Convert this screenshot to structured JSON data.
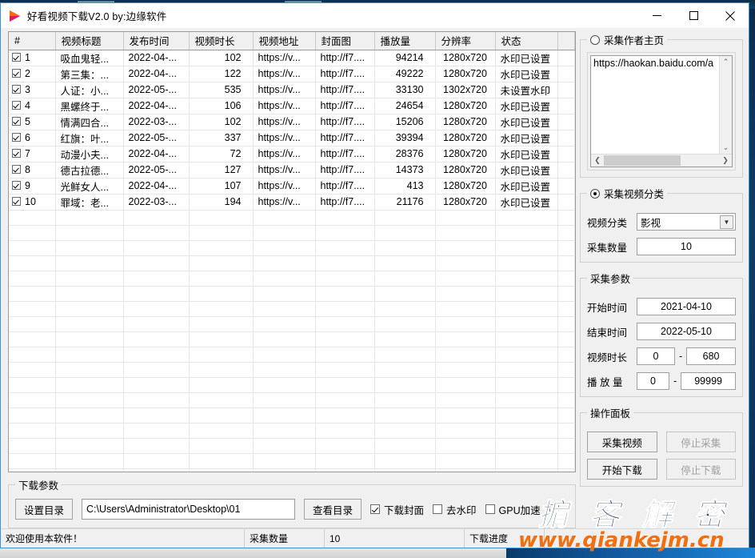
{
  "window": {
    "title": "好看视频下载V2.0 by:边缘软件",
    "logo_icon": "play-triangle-logo",
    "minimize_label": "—",
    "maximize_label": "□",
    "close_label": "✕"
  },
  "table": {
    "columns": [
      "#",
      "视频标题",
      "发布时间",
      "视频时长",
      "视频地址",
      "封面图",
      "播放量",
      "分辨率",
      "状态",
      ""
    ],
    "rows": [
      {
        "checked": true,
        "num": "1",
        "title": "吸血鬼轻...",
        "date": "2022-04-...",
        "duration": "102",
        "url": "https://v...",
        "cover": "http://f7....",
        "plays": "94214",
        "res": "1280x720",
        "status": "水印已设置"
      },
      {
        "checked": true,
        "num": "2",
        "title": "第三集：...",
        "date": "2022-04-...",
        "duration": "122",
        "url": "https://v...",
        "cover": "http://f7....",
        "plays": "49222",
        "res": "1280x720",
        "status": "水印已设置"
      },
      {
        "checked": true,
        "num": "3",
        "title": "人证：小...",
        "date": "2022-05-...",
        "duration": "535",
        "url": "https://v...",
        "cover": "http://f7....",
        "plays": "33130",
        "res": "1302x720",
        "status": "未设置水印"
      },
      {
        "checked": true,
        "num": "4",
        "title": "黑螺终于...",
        "date": "2022-04-...",
        "duration": "106",
        "url": "https://v...",
        "cover": "http://f7....",
        "plays": "24654",
        "res": "1280x720",
        "status": "水印已设置"
      },
      {
        "checked": true,
        "num": "5",
        "title": "情满四合...",
        "date": "2022-03-...",
        "duration": "102",
        "url": "https://v...",
        "cover": "http://f7....",
        "plays": "15206",
        "res": "1280x720",
        "status": "水印已设置"
      },
      {
        "checked": true,
        "num": "6",
        "title": "红旗：叶...",
        "date": "2022-05-...",
        "duration": "337",
        "url": "https://v...",
        "cover": "http://f7....",
        "plays": "39394",
        "res": "1280x720",
        "status": "水印已设置"
      },
      {
        "checked": true,
        "num": "7",
        "title": "动漫小夫...",
        "date": "2022-04-...",
        "duration": "72",
        "url": "https://v...",
        "cover": "http://f7....",
        "plays": "28376",
        "res": "1280x720",
        "status": "水印已设置"
      },
      {
        "checked": true,
        "num": "8",
        "title": "德古拉德...",
        "date": "2022-05-...",
        "duration": "127",
        "url": "https://v...",
        "cover": "http://f7....",
        "plays": "14373",
        "res": "1280x720",
        "status": "水印已设置"
      },
      {
        "checked": true,
        "num": "9",
        "title": "光鲜女人...",
        "date": "2022-04-...",
        "duration": "107",
        "url": "https://v...",
        "cover": "http://f7....",
        "plays": "413",
        "res": "1280x720",
        "status": "水印已设置"
      },
      {
        "checked": true,
        "num": "10",
        "title": "罪域：老...",
        "date": "2022-03-...",
        "duration": "194",
        "url": "https://v...",
        "cover": "http://f7....",
        "plays": "21176",
        "res": "1280x720",
        "status": "水印已设置"
      }
    ]
  },
  "author_home": {
    "legend": "采集作者主页",
    "radio_selected": false,
    "url_value": "https://haokan.baidu.com/a",
    "scroll_up_icon": "chevron-up-icon",
    "scroll_down_icon": "chevron-down-icon",
    "scroll_left_icon": "‹",
    "scroll_right_icon": "›"
  },
  "video_category": {
    "legend": "采集视频分类",
    "radio_selected": true,
    "category_label": "视频分类",
    "category_value": "影视",
    "dropdown_icon": "▼",
    "count_label": "采集数量",
    "count_value": "10"
  },
  "collect_params": {
    "legend": "采集参数",
    "start_label": "开始时间",
    "start_value": "2021-04-10",
    "end_label": "结束时间",
    "end_value": "2022-05-10",
    "duration_label": "视频时长",
    "duration_min": "0",
    "duration_max": "680",
    "plays_label": "播 放 量",
    "plays_min": "0",
    "plays_max": "99999",
    "separator": "-"
  },
  "operation_panel": {
    "legend": "操作面板",
    "collect_button": "采集视频",
    "stop_collect_button": "停止采集",
    "start_download_button": "开始下载",
    "stop_download_button": "停止下载"
  },
  "download_params": {
    "legend": "下载参数",
    "set_dir_button": "设置目录",
    "path_value": "C:\\Users\\Administrator\\Desktop\\01",
    "view_dir_button": "查看目录",
    "checkbox_cover": "下载封面",
    "checkbox_cover_checked": true,
    "checkbox_nowatermark": "去水印",
    "checkbox_nowatermark_checked": false,
    "checkbox_gpu": "GPU加速",
    "checkbox_gpu_checked": false
  },
  "statusbar": {
    "message": "欢迎使用本软件！",
    "count_label": "采集数量",
    "count_value": "10",
    "progress_label": "下载进度",
    "progress_value": ""
  },
  "watermark": {
    "chinese": "掮 客 解 密",
    "url": "www.qiankejm.cn",
    "color_chinese": "#17365d",
    "color_url": "#f07010"
  },
  "colors": {
    "window_border": "#3c93d4",
    "face": "#f0f0f0",
    "field_border": "#9a9a9a",
    "disabled_text": "#a0a0a0"
  }
}
